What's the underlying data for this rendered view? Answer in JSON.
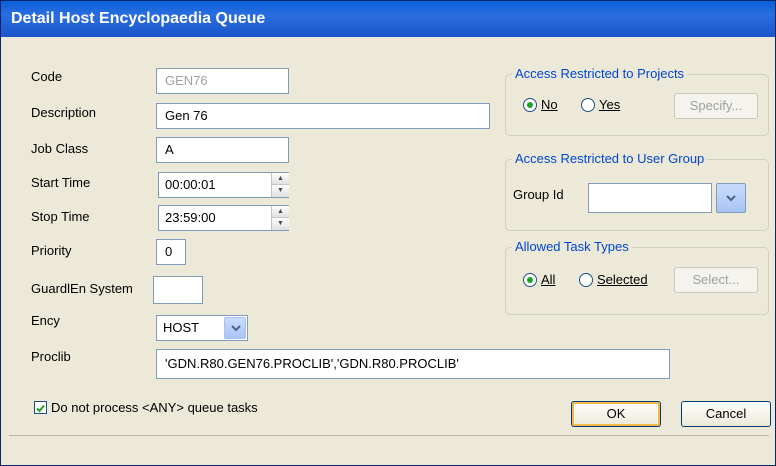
{
  "window": {
    "title": "Detail Host Encyclopaedia Queue"
  },
  "form": {
    "code": {
      "label": "Code",
      "value": "GEN76"
    },
    "description": {
      "label": "Description",
      "value": "Gen 76"
    },
    "job_class": {
      "label": "Job Class",
      "value": "A"
    },
    "start_time": {
      "label": "Start Time",
      "value": "00:00:01"
    },
    "stop_time": {
      "label": "Stop Time",
      "value": "23:59:00"
    },
    "priority": {
      "label": "Priority",
      "value": "0"
    },
    "guardlen": {
      "label": "GuardlEn System",
      "value": ""
    },
    "ency": {
      "label": "Ency",
      "value": "HOST"
    },
    "proclib": {
      "label": "Proclib",
      "value": "'GDN.R80.GEN76.PROCLIB','GDN.R80.PROCLIB'"
    }
  },
  "access_projects": {
    "legend": "Access Restricted to Projects",
    "no_label": "No",
    "yes_label": "Yes",
    "selected": "No",
    "specify_label": "Specify..."
  },
  "access_user_group": {
    "legend": "Access Restricted to User Group",
    "group_id_label": "Group Id",
    "group_id_value": ""
  },
  "task_types": {
    "legend": "Allowed Task Types",
    "all_label": "All",
    "selected_label": "Selected",
    "selected": "All",
    "select_label": "Select..."
  },
  "options": {
    "do_not_process_label": "Do not process <ANY> queue tasks",
    "do_not_process_checked": true
  },
  "buttons": {
    "ok": "OK",
    "cancel": "Cancel"
  },
  "colors": {
    "title_bar": "#0a5fd8",
    "group_legend": "#0046d5",
    "radio_dot": "#21a121"
  }
}
